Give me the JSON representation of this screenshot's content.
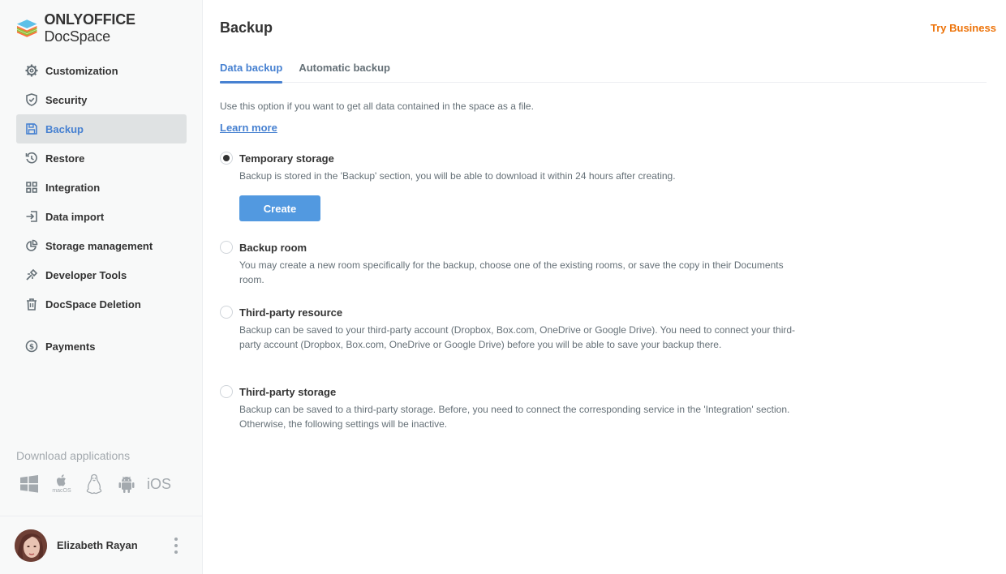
{
  "brand": {
    "name_bold": "ONLYOFFICE",
    "name_rest": " DocSpace"
  },
  "sidebar": {
    "items": [
      {
        "label": "Customization",
        "icon": "gear-icon"
      },
      {
        "label": "Security",
        "icon": "shield-icon"
      },
      {
        "label": "Backup",
        "icon": "floppy-disk-icon",
        "active": true
      },
      {
        "label": "Restore",
        "icon": "restore-clock-icon"
      },
      {
        "label": "Integration",
        "icon": "grid-icon"
      },
      {
        "label": "Data import",
        "icon": "import-icon"
      },
      {
        "label": "Storage management",
        "icon": "pie-chart-icon"
      },
      {
        "label": "Developer Tools",
        "icon": "wrench-icon"
      },
      {
        "label": "DocSpace Deletion",
        "icon": "trash-icon"
      },
      {
        "label": "Payments",
        "icon": "dollar-icon"
      }
    ],
    "download_title": "Download applications",
    "apps": [
      "windows-icon",
      "macos-icon",
      "linux-icon",
      "android-icon",
      "ios-icon"
    ],
    "app_labels": {
      "macos": "macOS",
      "ios": "iOS"
    },
    "user": {
      "name": "Elizabeth Rayan"
    }
  },
  "header": {
    "title": "Backup",
    "try_business": "Try Business"
  },
  "tabs": [
    {
      "label": "Data backup",
      "active": true
    },
    {
      "label": "Automatic backup",
      "active": false
    }
  ],
  "content": {
    "description": "Use this option if you want to get all data contained in the space as a file.",
    "learn_more": "Learn more",
    "create_label": "Create",
    "options": [
      {
        "label": "Temporary storage",
        "checked": true,
        "description": "Backup is stored in the 'Backup' section, you will be able to download it within 24 hours after creating."
      },
      {
        "label": "Backup room",
        "checked": false,
        "description": "You may create a new room specifically for the backup, choose one of the existing rooms, or save the copy in their Documents room."
      },
      {
        "label": "Third-party resource",
        "checked": false,
        "description": "Backup can be saved to your third-party account (Dropbox, Box.com, OneDrive or Google Drive). You need to connect your third-party account (Dropbox, Box.com, OneDrive or Google Drive) before you will be able to save your backup there."
      },
      {
        "label": "Third-party storage",
        "checked": false,
        "description": "Backup can be saved to a third-party storage. Before, you need to connect the corresponding service in the 'Integration' section. Otherwise, the following settings will be inactive."
      }
    ]
  },
  "colors": {
    "accent": "#4781d1",
    "button": "#5299e0",
    "try_business": "#ed7309",
    "sidebar_bg": "#f8f9f9"
  }
}
